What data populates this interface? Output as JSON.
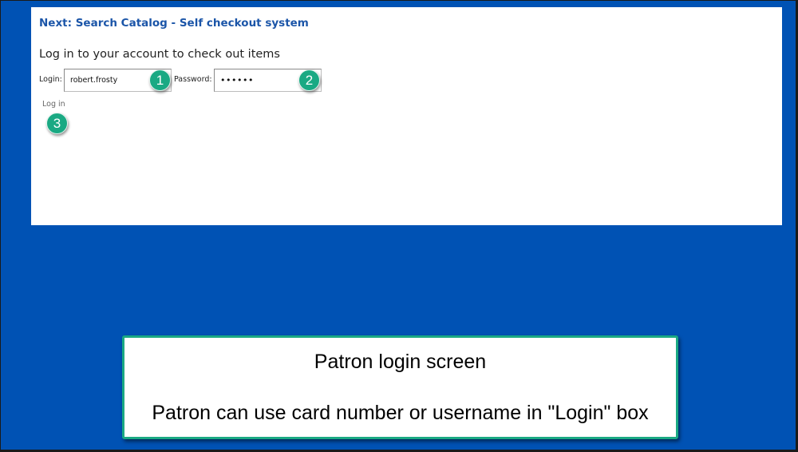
{
  "app": {
    "title": "Next: Search Catalog - Self checkout system",
    "heading": "Log in to your account to check out items"
  },
  "login_form": {
    "login_label": "Login:",
    "login_value": "robert.frosty",
    "password_label": "Password:",
    "password_value": "••••••",
    "submit_label": "Log in"
  },
  "callouts": {
    "step1": "1",
    "step2": "2",
    "step3": "3"
  },
  "caption": {
    "title": "Patron login screen",
    "body": "Patron can use card number or username in \"Login\" box"
  },
  "colors": {
    "background": "#0052b4",
    "accent": "#1aa983",
    "title_text": "#1b55a8"
  }
}
